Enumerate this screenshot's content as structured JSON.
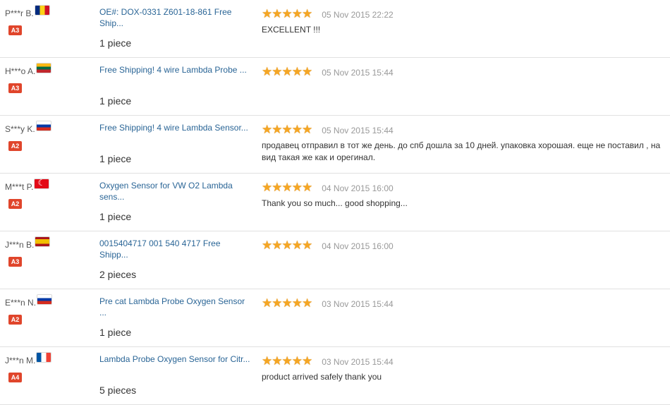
{
  "colors": {
    "link": "#2a6596",
    "badge": "#e0452b",
    "star": "#f5a623",
    "divider": "#e1e1e1"
  },
  "feedback": [
    {
      "buyer": "P***r B.",
      "flag": "romania-flag-icon",
      "flag_colors": [
        "#002b7f",
        "#fcd116",
        "#ce1126"
      ],
      "flag_orientation": "vertical",
      "level": "A3",
      "product": "OE#: DOX-0331 Z601-18-861 Free Ship...",
      "quantity": "1 piece",
      "stars": 5,
      "date": "05 Nov 2015 22:22",
      "comment": "EXCELLENT !!!"
    },
    {
      "buyer": "H***o A.",
      "flag": "lithuania-flag-icon",
      "flag_colors": [
        "#fdb913",
        "#006a44",
        "#c1272d"
      ],
      "flag_orientation": "horizontal",
      "level": "A3",
      "product": "Free Shipping! 4 wire Lambda Probe ...",
      "quantity": "1 piece",
      "stars": 5,
      "date": "05 Nov 2015 15:44",
      "comment": ""
    },
    {
      "buyer": "S***y K.",
      "flag": "russia-flag-icon",
      "flag_colors": [
        "#ffffff",
        "#0039a6",
        "#d52b1e"
      ],
      "flag_orientation": "horizontal",
      "level": "A2",
      "product": "Free Shipping! 4 wire Lambda Sensor...",
      "quantity": "1 piece",
      "stars": 5,
      "date": "05 Nov 2015 15:44",
      "comment": "продавец отправил в тот же день. до спб дошла за 10 дней. упаковка хорошая. еще не поставил , на вид такая же как и орегинал."
    },
    {
      "buyer": "M***t P.",
      "flag": "turkey-flag-icon",
      "flag_colors": [
        "#e30a17",
        "#ffffff"
      ],
      "flag_orientation": "turkey",
      "level": "A2",
      "product": "Oxygen Sensor for VW O2 Lambda sens...",
      "quantity": "1 piece",
      "stars": 5,
      "date": "04 Nov 2015 16:00",
      "comment": "Thank you so much... good shopping..."
    },
    {
      "buyer": "J***n B.",
      "flag": "spain-flag-icon",
      "flag_colors": [
        "#aa151b",
        "#f1bf00",
        "#aa151b"
      ],
      "flag_orientation": "spain",
      "level": "A3",
      "product": "0015404717 001 540 4717 Free Shipp...",
      "quantity": "2 pieces",
      "stars": 5,
      "date": "04 Nov 2015 16:00",
      "comment": ""
    },
    {
      "buyer": "E***n N.",
      "flag": "russia-flag-icon",
      "flag_colors": [
        "#ffffff",
        "#0039a6",
        "#d52b1e"
      ],
      "flag_orientation": "horizontal",
      "level": "A2",
      "product": "Pre cat Lambda Probe Oxygen Sensor ...",
      "quantity": "1 piece",
      "stars": 5,
      "date": "03 Nov 2015 15:44",
      "comment": ""
    },
    {
      "buyer": "J***n M.",
      "flag": "france-flag-icon",
      "flag_colors": [
        "#0055a4",
        "#ffffff",
        "#ef4135"
      ],
      "flag_orientation": "vertical",
      "level": "A4",
      "product": "Lambda Probe Oxygen Sensor for Citr...",
      "quantity": "5 pieces",
      "stars": 5,
      "date": "03 Nov 2015 15:44",
      "comment": "product arrived safely thank you"
    }
  ]
}
